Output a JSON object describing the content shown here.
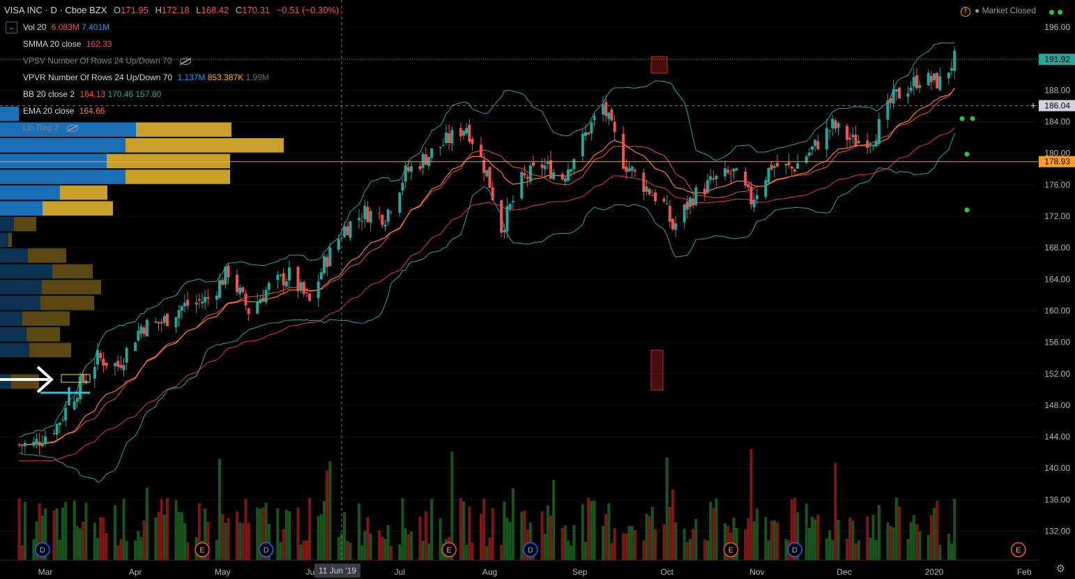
{
  "header": {
    "symbol": "VISA INC · D · Cboe BZX",
    "o_label": "O",
    "o": "171.95",
    "h_label": "H",
    "h": "172.18",
    "l_label": "L",
    "l": "168.42",
    "c_label": "C",
    "c": "170.31",
    "change": "−0.51 (−0.30%)",
    "market_status": "Market Closed"
  },
  "legend": {
    "vol": {
      "name": "Vol 20",
      "v1": "6.083M",
      "v2": "7.401M"
    },
    "smma": {
      "name": "SMMA 20 close",
      "v1": "162.33"
    },
    "vpsv": {
      "name": "VPSV Number Of Rows 24 Up/Down 70"
    },
    "vpvr": {
      "name": "VPVR Number Of Rows 24 Up/Down 70",
      "v1": "1.137M",
      "v2": "853.387K",
      "v3": "1.99M"
    },
    "bb": {
      "name": "BB 20 close 2",
      "v1": "164.13",
      "v2": "170.46",
      "v3": "157.80"
    },
    "ema": {
      "name": "EMA 20 close",
      "v1": "164.66"
    },
    "linreg": {
      "name": "Lin Reg 2"
    }
  },
  "colors": {
    "up": "#26a69a",
    "down": "#ef5350",
    "vp_up": "#1a6fb5",
    "vp_down": "#c8a02a",
    "bb": "#2aa3a3",
    "ema": "#ff7b2a",
    "smma": "#e03c3c",
    "hline": "#ff9f2a",
    "accent": "#2962ff",
    "vol_up": "#1b5e20",
    "vol_down": "#8b1a1a"
  },
  "chart_data": {
    "type": "candlestick",
    "ylim": [
      130,
      197
    ],
    "y_ticks": [
      132,
      136,
      140,
      144,
      148,
      152,
      156,
      160,
      164,
      168,
      172,
      176,
      180,
      184,
      188,
      192,
      196
    ],
    "x_labels": [
      "Mar",
      "Apr",
      "May",
      "Jun",
      "Jul",
      "Aug",
      "Sep",
      "Oct",
      "Nov",
      "Dec",
      "2020",
      "Feb"
    ],
    "price_tags": {
      "last": "191.92",
      "crosshair": "186.04",
      "level": "178.93"
    },
    "crosshair_date": "11 Jun '19",
    "event_markers": [
      {
        "date": "2019-02-28",
        "label": "D"
      },
      {
        "date": "2019-04-24",
        "label": "E"
      },
      {
        "date": "2019-05-16",
        "label": "D"
      },
      {
        "date": "2019-07-18",
        "label": "E"
      },
      {
        "date": "2019-08-15",
        "label": "D"
      },
      {
        "date": "2019-10-23",
        "label": "E"
      },
      {
        "date": "2019-11-14",
        "label": "D"
      },
      {
        "date": "2020-01-30",
        "label": "E"
      }
    ],
    "close_series": [
      {
        "date": "2019-02-25",
        "close": 143.0
      },
      {
        "date": "2019-03-05",
        "close": 145.5
      },
      {
        "date": "2019-03-12",
        "close": 150.0
      },
      {
        "date": "2019-03-19",
        "close": 154.0
      },
      {
        "date": "2019-03-26",
        "close": 153.0
      },
      {
        "date": "2019-04-03",
        "close": 158.0
      },
      {
        "date": "2019-04-10",
        "close": 158.5
      },
      {
        "date": "2019-04-17",
        "close": 160.5
      },
      {
        "date": "2019-04-26",
        "close": 161.5
      },
      {
        "date": "2019-05-03",
        "close": 165.0
      },
      {
        "date": "2019-05-10",
        "close": 160.0
      },
      {
        "date": "2019-05-17",
        "close": 163.0
      },
      {
        "date": "2019-05-24",
        "close": 164.5
      },
      {
        "date": "2019-05-31",
        "close": 161.0
      },
      {
        "date": "2019-06-05",
        "close": 166.0
      },
      {
        "date": "2019-06-12",
        "close": 170.5
      },
      {
        "date": "2019-06-19",
        "close": 172.5
      },
      {
        "date": "2019-06-26",
        "close": 172.0
      },
      {
        "date": "2019-07-03",
        "close": 177.5
      },
      {
        "date": "2019-07-10",
        "close": 179.5
      },
      {
        "date": "2019-07-17",
        "close": 181.5
      },
      {
        "date": "2019-07-24",
        "close": 183.5
      },
      {
        "date": "2019-07-31",
        "close": 177.5
      },
      {
        "date": "2019-08-05",
        "close": 170.5
      },
      {
        "date": "2019-08-12",
        "close": 176.5
      },
      {
        "date": "2019-08-19",
        "close": 178.5
      },
      {
        "date": "2019-08-26",
        "close": 177.0
      },
      {
        "date": "2019-09-04",
        "close": 183.0
      },
      {
        "date": "2019-09-09",
        "close": 186.0
      },
      {
        "date": "2019-09-16",
        "close": 179.0
      },
      {
        "date": "2019-09-23",
        "close": 176.0
      },
      {
        "date": "2019-09-30",
        "close": 173.5
      },
      {
        "date": "2019-10-03",
        "close": 170.5
      },
      {
        "date": "2019-10-10",
        "close": 174.5
      },
      {
        "date": "2019-10-17",
        "close": 176.5
      },
      {
        "date": "2019-10-24",
        "close": 177.5
      },
      {
        "date": "2019-10-30",
        "close": 174.0
      },
      {
        "date": "2019-11-06",
        "close": 178.5
      },
      {
        "date": "2019-11-13",
        "close": 178.0
      },
      {
        "date": "2019-11-20",
        "close": 180.5
      },
      {
        "date": "2019-11-27",
        "close": 183.5
      },
      {
        "date": "2019-12-04",
        "close": 181.5
      },
      {
        "date": "2019-12-11",
        "close": 182.0
      },
      {
        "date": "2019-12-18",
        "close": 187.0
      },
      {
        "date": "2019-12-27",
        "close": 189.5
      },
      {
        "date": "2020-01-03",
        "close": 189.0
      },
      {
        "date": "2020-01-08",
        "close": 191.9
      }
    ],
    "volume_profile": [
      {
        "price_low": 184.0,
        "price_high": 186.0,
        "up": 27,
        "down": 0
      },
      {
        "price_low": 182.0,
        "price_high": 184.0,
        "up": 195,
        "down": 137
      },
      {
        "price_low": 180.0,
        "price_high": 182.0,
        "up": 180,
        "down": 227
      },
      {
        "price_low": 178.0,
        "price_high": 180.0,
        "up": 153,
        "down": 177
      },
      {
        "price_low": 176.0,
        "price_high": 178.0,
        "up": 180,
        "down": 150
      },
      {
        "price_low": 174.0,
        "price_high": 176.0,
        "up": 86,
        "down": 68
      },
      {
        "price_low": 172.0,
        "price_high": 174.0,
        "up": 61,
        "down": 101
      },
      {
        "price_low": 170.0,
        "price_high": 172.0,
        "up": 20,
        "down": 32
      },
      {
        "price_low": 168.0,
        "price_high": 170.0,
        "up": 12,
        "down": 5
      },
      {
        "price_low": 166.0,
        "price_high": 168.0,
        "up": 40,
        "down": 55
      },
      {
        "price_low": 164.0,
        "price_high": 166.0,
        "up": 75,
        "down": 58
      },
      {
        "price_low": 162.0,
        "price_high": 164.0,
        "up": 60,
        "down": 85
      },
      {
        "price_low": 160.0,
        "price_high": 162.0,
        "up": 58,
        "down": 77
      },
      {
        "price_low": 158.0,
        "price_high": 160.0,
        "up": 32,
        "down": 68
      },
      {
        "price_low": 156.0,
        "price_high": 158.0,
        "up": 38,
        "down": 48
      },
      {
        "price_low": 154.0,
        "price_high": 156.0,
        "up": 42,
        "down": 60
      },
      {
        "price_low": 150.0,
        "price_high": 152.0,
        "up": 16,
        "down": 40
      }
    ]
  }
}
